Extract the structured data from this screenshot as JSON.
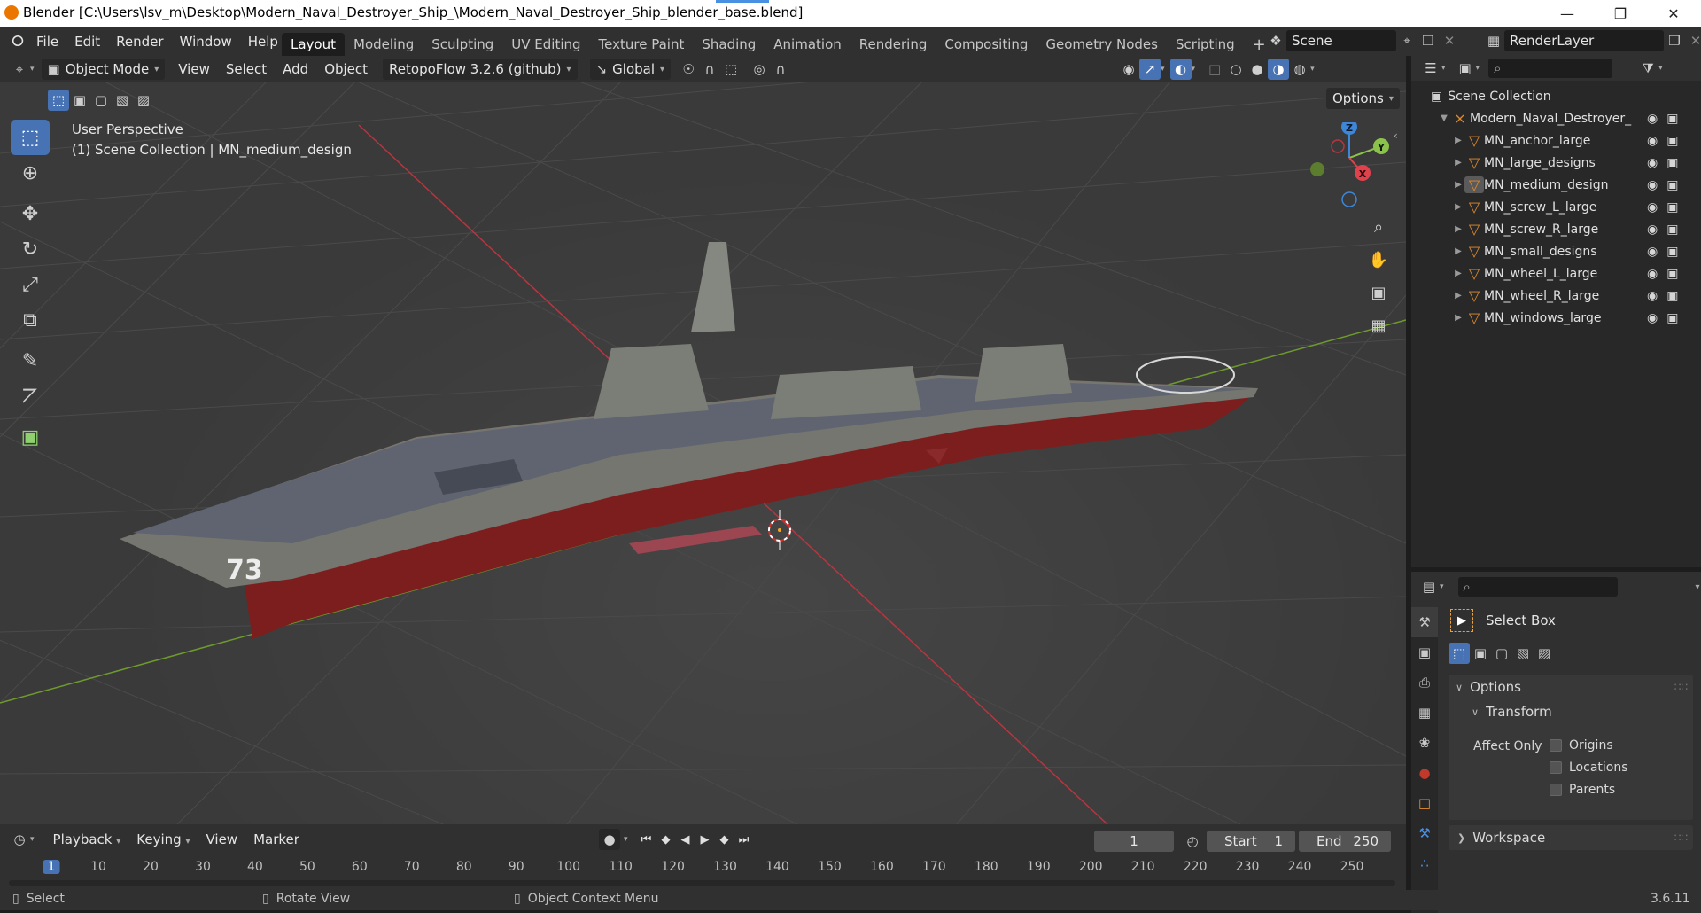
{
  "window": {
    "title": "Blender [C:\\Users\\lsv_m\\Desktop\\Modern_Naval_Destroyer_Ship_\\Modern_Naval_Destroyer_Ship_blender_base.blend]",
    "minimize": "—",
    "restore": "❐",
    "close": "✕"
  },
  "menubar": {
    "items": [
      "File",
      "Edit",
      "Render",
      "Window",
      "Help"
    ],
    "workspaces": [
      "Layout",
      "Modeling",
      "Sculpting",
      "UV Editing",
      "Texture Paint",
      "Shading",
      "Animation",
      "Rendering",
      "Compositing",
      "Geometry Nodes",
      "Scripting"
    ],
    "add_tab": "+",
    "scene": "Scene",
    "render_layer": "RenderLayer"
  },
  "viewport_header": {
    "mode": "Object Mode",
    "menus": [
      "View",
      "Select",
      "Add",
      "Object"
    ],
    "addon": "RetopoFlow 3.2.6 (github)",
    "orientation": "Global",
    "options": "Options"
  },
  "viewport": {
    "perspective": "User Perspective",
    "collection_info": "(1) Scene Collection | MN_medium_design",
    "hull_number": "73",
    "gizmo": {
      "z": "Z",
      "y": "Y",
      "x": "X"
    }
  },
  "outliner": {
    "root": "Scene Collection",
    "collection": "Modern_Naval_Destroyer_",
    "objects": [
      "MN_anchor_large",
      "MN_large_designs",
      "MN_medium_design",
      "MN_screw_L_large",
      "MN_screw_R_large",
      "MN_small_designs",
      "MN_wheel_L_large",
      "MN_wheel_R_large",
      "MN_windows_large"
    ],
    "active_object": "MN_medium_design"
  },
  "properties": {
    "tool_name": "Select Box",
    "options_label": "Options",
    "transform_label": "Transform",
    "affect_only_label": "Affect Only",
    "checkboxes": [
      "Origins",
      "Locations",
      "Parents"
    ],
    "workspace_label": "Workspace"
  },
  "timeline": {
    "menus": [
      "Playback",
      "Keying",
      "View",
      "Marker"
    ],
    "current_frame": "1",
    "start_label": "Start",
    "start": "1",
    "end_label": "End",
    "end": "250",
    "ruler": [
      "1",
      "10",
      "20",
      "30",
      "40",
      "50",
      "60",
      "70",
      "80",
      "90",
      "100",
      "110",
      "120",
      "130",
      "140",
      "150",
      "160",
      "170",
      "180",
      "190",
      "200",
      "210",
      "220",
      "230",
      "240",
      "250"
    ]
  },
  "statusbar": {
    "select": "Select",
    "rotate": "Rotate View",
    "context": "Object Context Menu",
    "version": "3.6.11"
  },
  "colors": {
    "accent": "#4772b3",
    "object_icon": "#e38b2e",
    "x_axis": "#e0424d",
    "y_axis": "#8bc34a",
    "z_axis": "#3d86d8"
  }
}
